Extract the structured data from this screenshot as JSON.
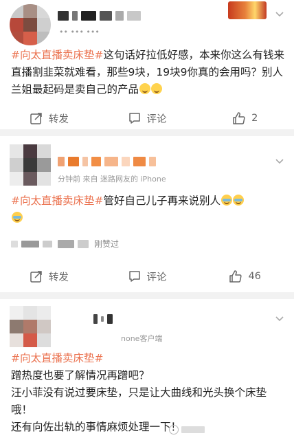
{
  "posts": [
    {
      "meta": "•• ••• •••",
      "content": {
        "tag": "#向太直播卖床垫#",
        "text": "这句话好拉低好感，本来你这么有钱来直播割韭菜就难看，那些9块，19块9你真的会用吗？别人兰姐最起码是卖自己的产品"
      },
      "actions": {
        "repost": "转发",
        "comment": "评论",
        "like_count": "2"
      }
    },
    {
      "meta": "分钟前  来自 迷路网友的 iPhone",
      "content": {
        "tag": "#向太直播卖床垫#",
        "text": "管好自己儿子再来说别人"
      },
      "liked_by": "刚赞过",
      "actions": {
        "repost": "转发",
        "comment": "评论",
        "like_count": "46"
      }
    },
    {
      "meta": "none客户端",
      "content": {
        "tag": "#向太直播卖床垫#",
        "line1": "蹭热度也要了解情况再蹭吧？",
        "line2": "汪小菲没有说过要床垫，只是让大曲线和光头换个床垫哦！",
        "line3": "还有向佐出轨的事情麻烦处理一下！"
      }
    }
  ],
  "colors": {
    "tag": "#eb7350",
    "meta": "#999999",
    "action": "#666666",
    "separator": "#f2f2f2"
  },
  "icons": [
    "repost-icon",
    "comment-icon",
    "like-icon",
    "chevron-down-icon",
    "emoji-sweat-icon",
    "emoji-cry-icon"
  ]
}
